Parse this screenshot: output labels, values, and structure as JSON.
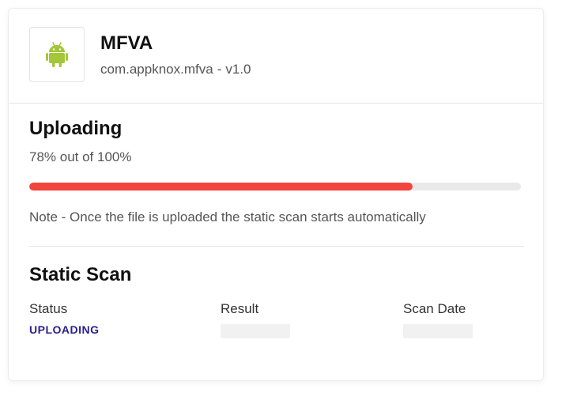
{
  "app": {
    "name": "MFVA",
    "package": "com.appknox.mfva",
    "separator": "-",
    "version": "v1.0",
    "platform_icon": "android-icon",
    "platform_color": "#a4c639"
  },
  "upload": {
    "title": "Uploading",
    "progress_text": "78% out of 100%",
    "progress_fraction": 0.78,
    "progress_color": "#f2453d",
    "note": "Note - Once the file is uploaded the static scan starts automatically"
  },
  "static_scan": {
    "title": "Static Scan",
    "columns": [
      {
        "label": "Status",
        "value": "UPLOADING"
      },
      {
        "label": "Result",
        "value": ""
      },
      {
        "label": "Scan Date",
        "value": ""
      }
    ],
    "status_color": "#2a1f8f"
  }
}
